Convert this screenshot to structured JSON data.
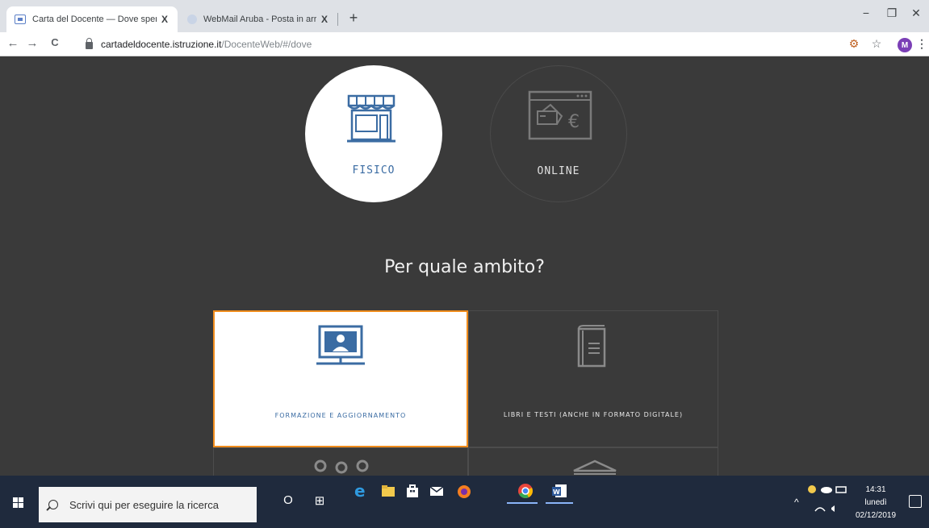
{
  "browser": {
    "tabs": [
      {
        "title": "Carta del Docente — Dove spend",
        "close": "X"
      },
      {
        "title": "WebMail Aruba - Posta in arrivo",
        "close": "X"
      }
    ],
    "new_tab": "+",
    "window_controls": {
      "minimize": "−",
      "restore": "❐",
      "close": "✕"
    },
    "nav": {
      "back": "←",
      "forward": "→",
      "reload": "C"
    },
    "url_host": "cartadeldocente.istruzione.it",
    "url_path": "/DocenteWeb/#/dove",
    "toolbar_icons": {
      "extension": "⚙",
      "bookmark": "☆",
      "menu": "⋮"
    },
    "profile_initial": "M"
  },
  "page": {
    "choices": [
      {
        "label": "FISICO",
        "selected": true
      },
      {
        "label": "ONLINE",
        "selected": false
      }
    ],
    "question": "Per quale ambito?",
    "categories": [
      {
        "label": "FORMAZIONE E AGGIORNAMENTO",
        "selected": true
      },
      {
        "label": "LIBRI E TESTI (ANCHE IN FORMATO DIGITALE)",
        "selected": false
      }
    ],
    "colors": {
      "accent": "#3b6ca3",
      "selection_border": "#f08c1c",
      "background": "#3a3a3a"
    }
  },
  "taskbar": {
    "search_placeholder": "Scrivi qui per eseguire la ricerca",
    "cortana": "O",
    "task_view": "⊞",
    "clock": {
      "time": "14:31",
      "day": "lunedì",
      "date": "02/12/2019"
    },
    "tray_chevron": "^"
  }
}
